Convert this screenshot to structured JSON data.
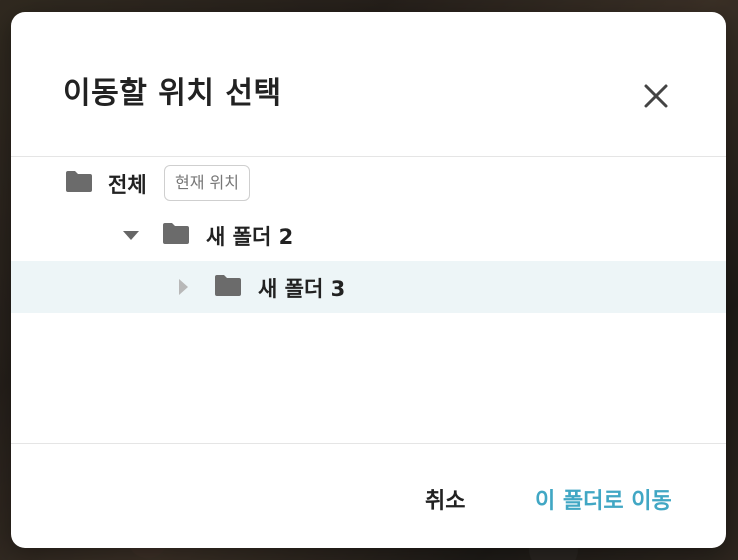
{
  "dialog": {
    "title": "이동할 위치 선택",
    "close_icon": "close-icon"
  },
  "tree": {
    "root": {
      "name": "전체",
      "badge": "현재 위치",
      "icon": "folder-icon"
    },
    "items": [
      {
        "name": "새 폴더 2",
        "expanded": true,
        "selected": false,
        "icon": "folder-icon"
      },
      {
        "name": "새 폴더 3",
        "expanded": false,
        "selected": true,
        "icon": "folder-icon"
      }
    ]
  },
  "footer": {
    "cancel_label": "취소",
    "move_label": "이 폴더로 이동"
  },
  "colors": {
    "accent": "#41a7c4",
    "selected_row": "#edf5f7",
    "folder": "#6b6b6b",
    "text": "#222222"
  }
}
